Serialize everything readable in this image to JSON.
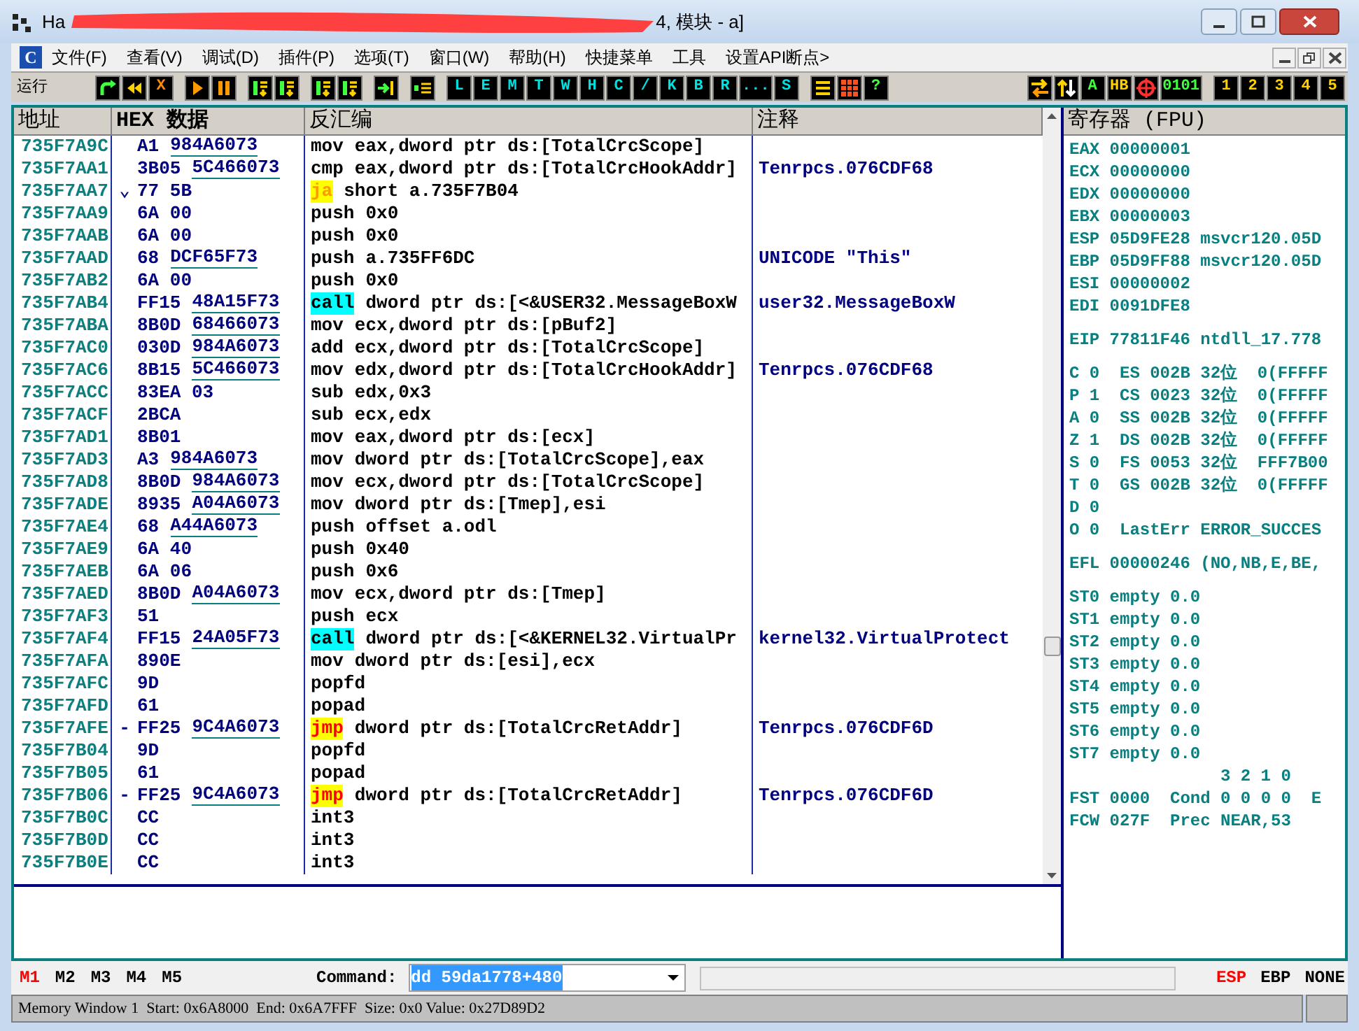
{
  "window": {
    "title_start": "Ha",
    "title_end": "4, 模块 - a]"
  },
  "menu": {
    "logo": "C",
    "items": [
      "文件(F)",
      "查看(V)",
      "调试(D)",
      "插件(P)",
      "选项(T)",
      "窗口(W)",
      "帮助(H)",
      "快捷菜单",
      "工具",
      "设置API断点>"
    ]
  },
  "toolbar": {
    "label": "运行",
    "left_groups": [
      [
        {
          "kind": "redo"
        },
        {
          "kind": "rewind"
        },
        {
          "kind": "stop",
          "label": "X"
        }
      ],
      [
        {
          "kind": "play"
        },
        {
          "kind": "pause"
        }
      ],
      [
        {
          "kind": "step"
        },
        {
          "kind": "step"
        }
      ],
      [
        {
          "kind": "step"
        },
        {
          "kind": "step"
        }
      ],
      [
        {
          "kind": "stepinto"
        }
      ],
      [
        {
          "kind": "runto"
        }
      ],
      [
        {
          "kind": "window",
          "label": "L"
        },
        {
          "kind": "window",
          "label": "E"
        },
        {
          "kind": "window",
          "label": "M"
        },
        {
          "kind": "window",
          "label": "T"
        },
        {
          "kind": "window",
          "label": "W"
        },
        {
          "kind": "window",
          "label": "H"
        },
        {
          "kind": "window",
          "label": "C"
        },
        {
          "kind": "window",
          "label": "/"
        },
        {
          "kind": "window",
          "label": "K"
        },
        {
          "kind": "window",
          "label": "B"
        },
        {
          "kind": "window",
          "label": "R"
        },
        {
          "kind": "window",
          "label": "..."
        },
        {
          "kind": "window",
          "label": "S"
        }
      ],
      [
        {
          "kind": "list"
        },
        {
          "kind": "grid"
        },
        {
          "kind": "toggle",
          "label": "?"
        }
      ]
    ],
    "right_groups": [
      [
        {
          "kind": "swap"
        },
        {
          "kind": "updown"
        },
        {
          "kind": "toggle",
          "label": "A"
        },
        {
          "kind": "number",
          "label": "HB"
        },
        {
          "kind": "target"
        },
        {
          "kind": "toggle",
          "label": "0101"
        }
      ],
      [
        {
          "kind": "number",
          "label": "1"
        },
        {
          "kind": "number",
          "label": "2"
        },
        {
          "kind": "number",
          "label": "3"
        },
        {
          "kind": "number",
          "label": "4"
        },
        {
          "kind": "number",
          "label": "5"
        }
      ]
    ]
  },
  "disassembly": {
    "columns": [
      "地址",
      "HEX 数据",
      "反汇编",
      "注释"
    ],
    "rows": [
      {
        "kind": "plain",
        "address": "735F7A9C",
        "hex": "A1",
        "hex_ref": "984A6073",
        "mnemonic": "mov",
        "operands": "eax,dword ptr ds:[TotalCrcScope]"
      },
      {
        "kind": "plain",
        "address": "735F7AA1",
        "hex": "3B05",
        "hex_ref": "5C466073",
        "mnemonic": "cmp",
        "operands": "eax,dword ptr ds:[TotalCrcHookAddr]",
        "comment": "Tenrpcs.076CDF68"
      },
      {
        "kind": "jcc",
        "address": "735F7AA7",
        "mark": "⌄",
        "hex": "77 5B",
        "mnemonic": "ja",
        "operands": "short a.735F7B04"
      },
      {
        "kind": "plain",
        "address": "735F7AA9",
        "hex": "6A 00",
        "mnemonic": "push",
        "operands": "0x0"
      },
      {
        "kind": "plain",
        "address": "735F7AAB",
        "hex": "6A 00",
        "mnemonic": "push",
        "operands": "0x0"
      },
      {
        "kind": "plain",
        "address": "735F7AAD",
        "hex": "68",
        "hex_ref": "DCF65F73",
        "mnemonic": "push",
        "operands": "a.735FF6DC",
        "comment": "UNICODE \"This\""
      },
      {
        "kind": "plain",
        "address": "735F7AB2",
        "hex": "6A 00",
        "mnemonic": "push",
        "operands": "0x0"
      },
      {
        "kind": "call",
        "address": "735F7AB4",
        "hex": "FF15",
        "hex_ref": "48A15F73",
        "mnemonic": "call",
        "operands": "dword ptr ds:[<&USER32.MessageBoxW",
        "comment": "user32.MessageBoxW"
      },
      {
        "kind": "plain",
        "address": "735F7ABA",
        "hex": "8B0D",
        "hex_ref": "68466073",
        "mnemonic": "mov",
        "operands": "ecx,dword ptr ds:[pBuf2]"
      },
      {
        "kind": "plain",
        "address": "735F7AC0",
        "hex": "030D",
        "hex_ref": "984A6073",
        "mnemonic": "add",
        "operands": "ecx,dword ptr ds:[TotalCrcScope]"
      },
      {
        "kind": "plain",
        "address": "735F7AC6",
        "hex": "8B15",
        "hex_ref": "5C466073",
        "mnemonic": "mov",
        "operands": "edx,dword ptr ds:[TotalCrcHookAddr]",
        "comment": "Tenrpcs.076CDF68"
      },
      {
        "kind": "plain",
        "address": "735F7ACC",
        "hex": "83EA 03",
        "mnemonic": "sub",
        "operands": "edx,0x3"
      },
      {
        "kind": "plain",
        "address": "735F7ACF",
        "hex": "2BCA",
        "mnemonic": "sub",
        "operands": "ecx,edx"
      },
      {
        "kind": "plain",
        "address": "735F7AD1",
        "hex": "8B01",
        "mnemonic": "mov",
        "operands": "eax,dword ptr ds:[ecx]"
      },
      {
        "kind": "plain",
        "address": "735F7AD3",
        "hex": "A3",
        "hex_ref": "984A6073",
        "mnemonic": "mov",
        "operands": "dword ptr ds:[TotalCrcScope],eax"
      },
      {
        "kind": "plain",
        "address": "735F7AD8",
        "hex": "8B0D",
        "hex_ref": "984A6073",
        "mnemonic": "mov",
        "operands": "ecx,dword ptr ds:[TotalCrcScope]"
      },
      {
        "kind": "plain",
        "address": "735F7ADE",
        "hex": "8935",
        "hex_ref": "A04A6073",
        "mnemonic": "mov",
        "operands": "dword ptr ds:[Tmep],esi"
      },
      {
        "kind": "plain",
        "address": "735F7AE4",
        "hex": "68",
        "hex_ref": "A44A6073",
        "mnemonic": "push",
        "operands": "offset a.odl"
      },
      {
        "kind": "plain",
        "address": "735F7AE9",
        "hex": "6A 40",
        "mnemonic": "push",
        "operands": "0x40"
      },
      {
        "kind": "plain",
        "address": "735F7AEB",
        "hex": "6A 06",
        "mnemonic": "push",
        "operands": "0x6"
      },
      {
        "kind": "plain",
        "address": "735F7AED",
        "hex": "8B0D",
        "hex_ref": "A04A6073",
        "mnemonic": "mov",
        "operands": "ecx,dword ptr ds:[Tmep]"
      },
      {
        "kind": "plain",
        "address": "735F7AF3",
        "hex": "51",
        "mnemonic": "push",
        "operands": "ecx"
      },
      {
        "kind": "call",
        "address": "735F7AF4",
        "hex": "FF15",
        "hex_ref": "24A05F73",
        "mnemonic": "call",
        "operands": "dword ptr ds:[<&KERNEL32.VirtualPr",
        "comment": "kernel32.VirtualProtect"
      },
      {
        "kind": "plain",
        "address": "735F7AFA",
        "hex": "890E",
        "mnemonic": "mov",
        "operands": "dword ptr ds:[esi],ecx"
      },
      {
        "kind": "plain",
        "address": "735F7AFC",
        "hex": "9D",
        "mnemonic": "popfd"
      },
      {
        "kind": "plain",
        "address": "735F7AFD",
        "hex": "61",
        "mnemonic": "popad"
      },
      {
        "kind": "jmp",
        "address": "735F7AFE",
        "mark": "-",
        "hex": "FF25",
        "hex_ref": "9C4A6073",
        "mnemonic": "jmp",
        "operands": "dword ptr ds:[TotalCrcRetAddr]",
        "comment": "Tenrpcs.076CDF6D"
      },
      {
        "kind": "plain",
        "address": "735F7B04",
        "hex": "9D",
        "mnemonic": "popfd"
      },
      {
        "kind": "plain",
        "address": "735F7B05",
        "hex": "61",
        "mnemonic": "popad"
      },
      {
        "kind": "jmp",
        "address": "735F7B06",
        "mark": "-",
        "hex": "FF25",
        "hex_ref": "9C4A6073",
        "mnemonic": "jmp",
        "operands": "dword ptr ds:[TotalCrcRetAddr]",
        "comment": "Tenrpcs.076CDF6D"
      },
      {
        "kind": "plain",
        "address": "735F7B0C",
        "hex": "CC",
        "mnemonic": "int3"
      },
      {
        "kind": "plain",
        "address": "735F7B0D",
        "hex": "CC",
        "mnemonic": "int3"
      },
      {
        "kind": "plain",
        "address": "735F7B0E",
        "hex": "CC",
        "mnemonic": "int3"
      }
    ]
  },
  "registers": {
    "title": "寄存器 (FPU)",
    "groups": [
      {
        "kind": "plain",
        "lines": [
          "EAX 00000001",
          "ECX 00000000",
          "EDX 00000000",
          "EBX 00000003",
          "ESP 05D9FE28 msvcr120.05D",
          "EBP 05D9FF88 msvcr120.05D",
          "ESI 00000002",
          "EDI 0091DFE8"
        ]
      },
      {
        "kind": "plain",
        "lines": [
          "EIP 77811F46 ntdll_17.778"
        ]
      },
      {
        "kind": "plain",
        "lines": [
          "C 0  ES 002B 32位  0(FFFFF",
          "P 1  CS 0023 32位  0(FFFFF",
          "A 0  SS 002B 32位  0(FFFFF",
          "Z 1  DS 002B 32位  0(FFFFF",
          "S 0  FS 0053 32位  FFF7B00",
          "T 0  GS 002B 32位  0(FFFFF",
          "D 0",
          "O 0  LastErr ERROR_SUCCES"
        ]
      },
      {
        "kind": "plain",
        "lines": [
          "EFL 00000246 (NO,NB,E,BE,"
        ]
      },
      {
        "kind": "plain",
        "lines": [
          "ST0 empty 0.0",
          "ST1 empty 0.0",
          "ST2 empty 0.0",
          "ST3 empty 0.0",
          "ST4 empty 0.0",
          "ST5 empty 0.0",
          "ST6 empty 0.0",
          "ST7 empty 0.0"
        ]
      },
      {
        "kind": "bit_header",
        "lines": [
          "3 2 1 0"
        ]
      },
      {
        "kind": "continued",
        "lines": [
          "FST 0000  Cond 0 0 0 0  E",
          "FCW 027F  Prec NEAR,53"
        ]
      }
    ]
  },
  "memory_tabs": [
    {
      "label": "M1",
      "selected": true
    },
    {
      "label": "M2",
      "selected": false
    },
    {
      "label": "M3",
      "selected": false
    },
    {
      "label": "M4",
      "selected": false
    },
    {
      "label": "M5",
      "selected": false
    }
  ],
  "command": {
    "label": "Command:",
    "value": "dd 59da1778+480"
  },
  "register_modes": [
    {
      "label": "ESP",
      "selected": true
    },
    {
      "label": "EBP",
      "selected": false
    },
    {
      "label": "NONE",
      "selected": false
    }
  ],
  "status_bar": "Memory Window 1  Start: 0x6A8000  End: 0x6A7FFF  Size: 0x0 Value: 0x27D89D2"
}
